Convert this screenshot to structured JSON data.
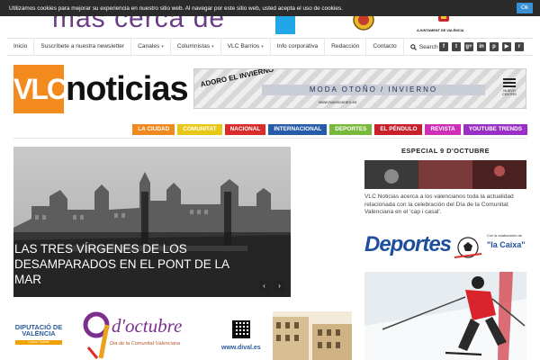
{
  "cookie": {
    "text": "Utilizamos cookies para mejorar su experiencia en nuestro sitio web. Al navegar por este sitio web, usted acepta el uso de cookies.",
    "ok_label": "Ok"
  },
  "top_banner": {
    "slogan": "mas cerca de",
    "ajuntament": "AJUNTAMENT DE VALÈNCIA"
  },
  "nav": {
    "items": [
      {
        "label": "Inicio"
      },
      {
        "label": "Suscríbete a nuestra newsletter"
      },
      {
        "label": "Canales",
        "caret": "▾"
      },
      {
        "label": "Columnistas",
        "caret": "▾"
      },
      {
        "label": "VLC Barrios",
        "caret": "▾"
      },
      {
        "label": "Info corporativa"
      },
      {
        "label": "Redacción"
      },
      {
        "label": "Contacto"
      }
    ],
    "search_label": "Search",
    "social": [
      "f",
      "t",
      "g+",
      "in",
      "p",
      "▶",
      "r"
    ]
  },
  "logo": {
    "vlc": "VLC",
    "noticias": "noticias"
  },
  "ad": {
    "adoro": "ADORO EL INVIERNO",
    "text": "MODA OTOÑO / INVIERNO",
    "url": "www.nuevocentro.es",
    "brand": "NUEVO CENTRO"
  },
  "categories": [
    {
      "label": "LA CIUDAD",
      "color": "#f18a1e"
    },
    {
      "label": "COMUNITAT",
      "color": "#e8c817"
    },
    {
      "label": "NACIONAL",
      "color": "#d92c2c"
    },
    {
      "label": "INTERNACIONAL",
      "color": "#275da8"
    },
    {
      "label": "DEPORTES",
      "color": "#78b83b"
    },
    {
      "label": "EL PÉNDULO",
      "color": "#c91f2b"
    },
    {
      "label": "REVISTA",
      "color": "#cf2fb7"
    },
    {
      "label": "YOUTUBE TRENDS",
      "color": "#9a2fc6"
    }
  ],
  "slider": {
    "title": "Las tres vírgenes de los desamparados en el Pont de la Mar",
    "prev": "‹",
    "next": "›"
  },
  "sidebar": {
    "special_title": "ESPECIAL 9 D'OCTUBRE",
    "special_desc": "VLC Noticias acerca a los valencianos toda la actualidad relacionada con la celebración del Día de la Comunitat Valenciana en el 'cap i casal'.",
    "deportes": "Deportes",
    "colab": "Con la colaboración de",
    "caixa": "\"la Caixa\""
  },
  "bottom": {
    "dip_title": "DIPUTACIÓ DE VALÈNCIA",
    "dip_sub": "Cultura i Turisme",
    "oct_title": "d'octubre",
    "oct_sub": "Dia de la Comunitat Valenciana",
    "dival": "www.dival.es"
  }
}
